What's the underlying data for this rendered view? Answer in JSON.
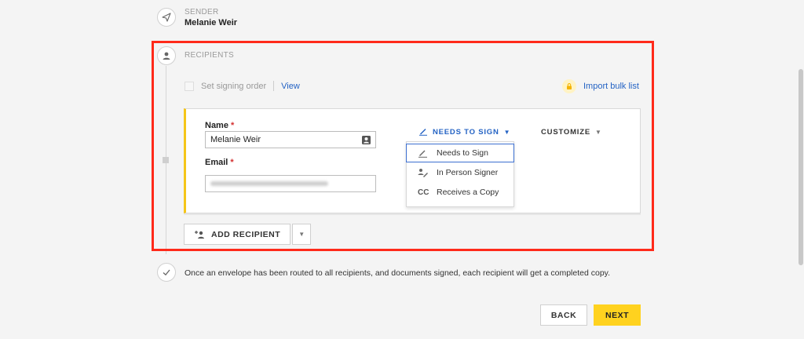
{
  "sender": {
    "section_label": "SENDER",
    "name": "Melanie Weir"
  },
  "recipients": {
    "section_label": "RECIPIENTS",
    "signing_order_label": "Set signing order",
    "view_link": "View",
    "import_bulk_label": "Import bulk list",
    "card": {
      "name_label": "Name",
      "name_value": "Melanie Weir",
      "email_label": "Email",
      "role_button_label": "NEEDS TO SIGN",
      "customize_label": "CUSTOMIZE"
    },
    "role_menu": [
      {
        "label": "Needs to Sign",
        "icon": "pen-icon",
        "selected": true
      },
      {
        "label": "In Person Signer",
        "icon": "person-pen-icon",
        "selected": false
      },
      {
        "label": "Receives a Copy",
        "icon_text": "CC",
        "icon": "cc-icon",
        "selected": false
      }
    ],
    "add_recipient_label": "ADD RECIPIENT"
  },
  "completion": {
    "text": "Once an envelope has been routed to all recipients, and documents signed, each recipient will get a completed copy."
  },
  "footer": {
    "back_label": "BACK",
    "next_label": "NEXT"
  },
  "colors": {
    "accent_yellow": "#ffd21f",
    "link_blue": "#2463c4",
    "highlight_red": "#ff2a1a"
  }
}
